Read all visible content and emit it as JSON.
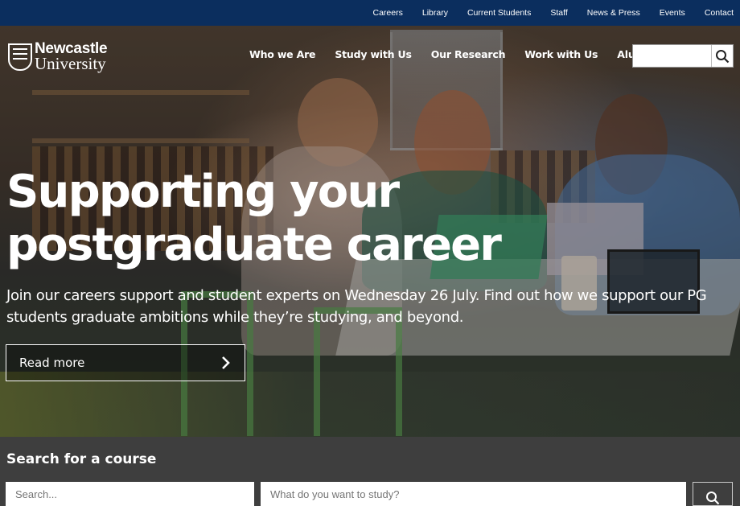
{
  "utility_nav": [
    "Careers",
    "Library",
    "Current Students",
    "Staff",
    "News & Press",
    "Events",
    "Contact"
  ],
  "logo": {
    "line1": "Newcastle",
    "line2": "University"
  },
  "main_nav": [
    "Who we Are",
    "Study with Us",
    "Our Research",
    "Work with Us",
    "Alumni"
  ],
  "search": {
    "placeholder": "",
    "icon": "search-icon"
  },
  "hero": {
    "title_line1": "Supporting your",
    "title_line2": "postgraduate career",
    "text": "Join our careers support and student experts on Wednesday 26 July. Find out how we support our PG students graduate ambitions while they’re studying, and beyond.",
    "button_label": "Read more",
    "button_icon": "chevron-right-icon"
  },
  "course_search": {
    "title": "Search for a course",
    "field1_placeholder": "Search...",
    "field2_placeholder": "What do you want to study?",
    "button_icon": "search-icon"
  },
  "colors": {
    "utility_bar": "#0b2e5e",
    "course_section": "#3e3e3e"
  }
}
